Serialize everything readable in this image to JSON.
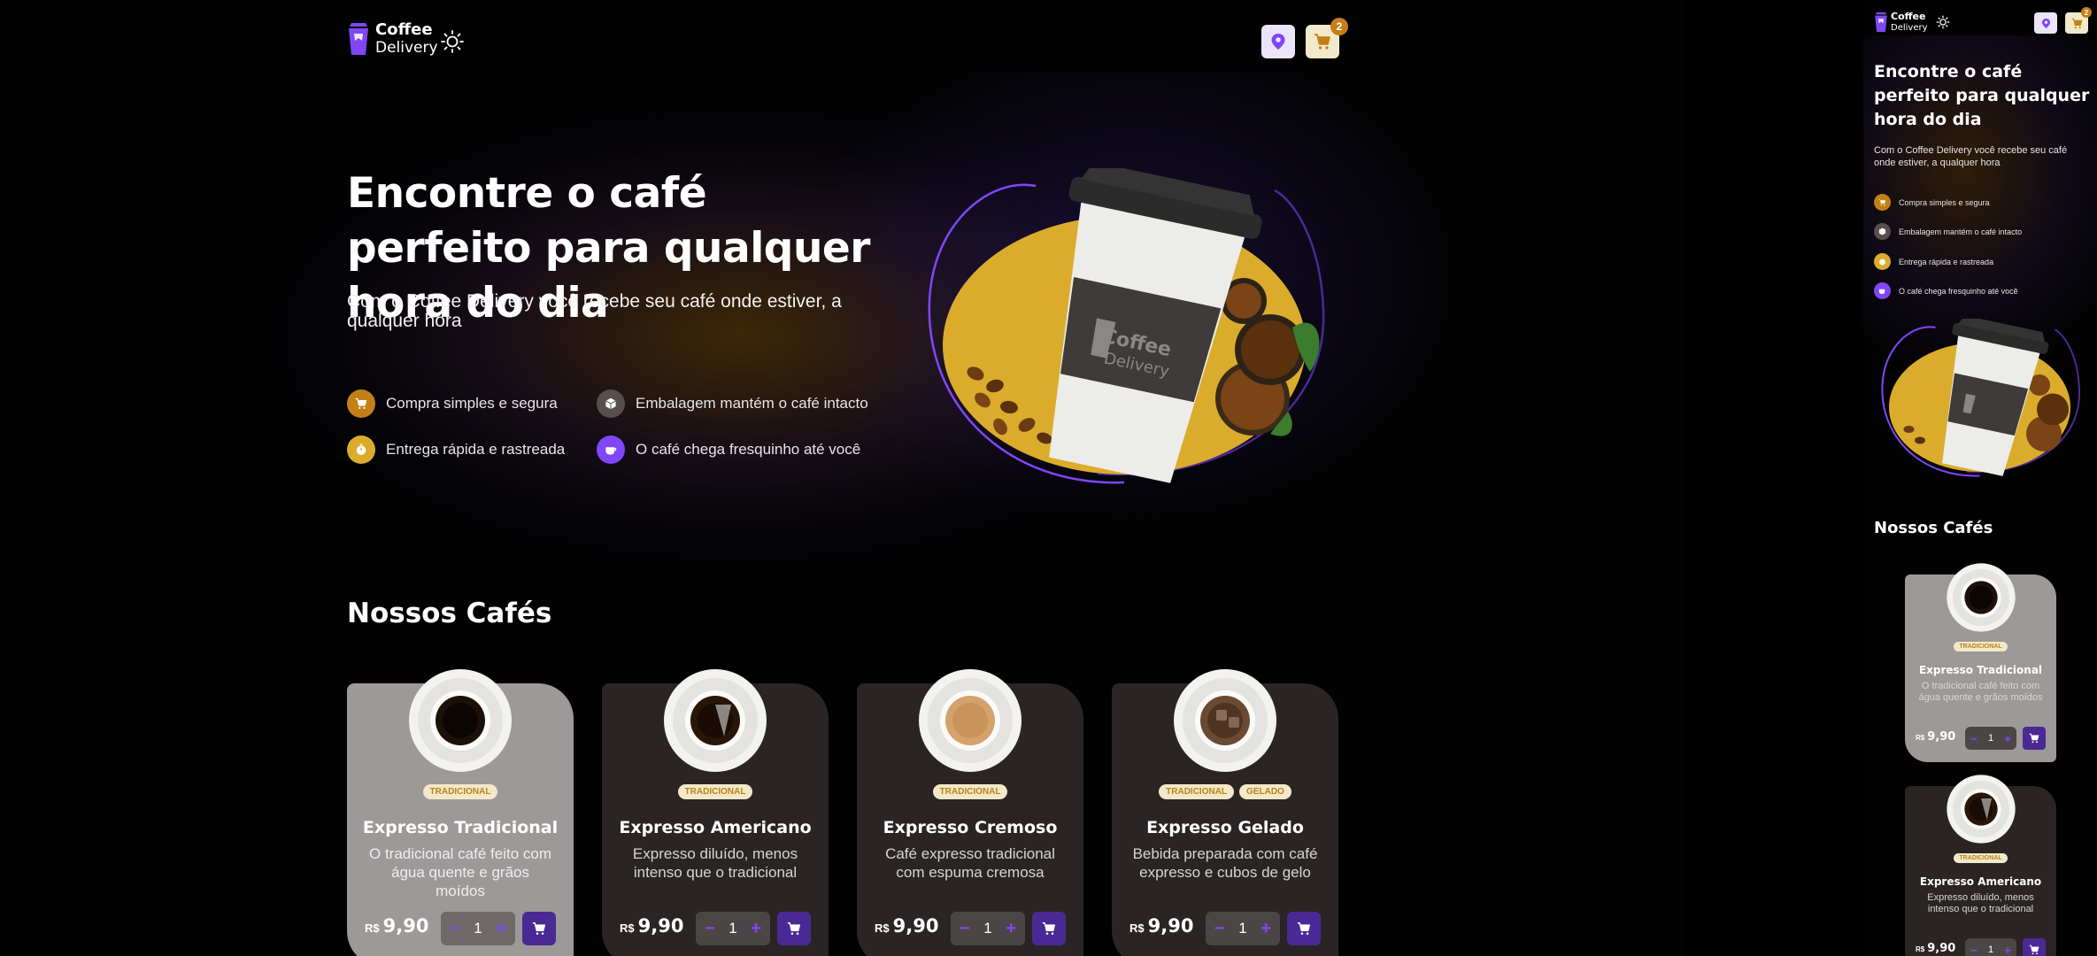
{
  "brand": {
    "line1": "Coffee",
    "line2": "Delivery"
  },
  "header": {
    "cart_count": "2",
    "location_icon": "map-pin-icon",
    "cart_icon": "shopping-cart-icon",
    "theme_icon": "sun-icon"
  },
  "hero": {
    "title": "Encontre o café perfeito para qualquer hora do dia",
    "subtitle": "Com o Coffee Delivery você recebe seu café onde estiver, a qualquer hora",
    "features": [
      {
        "label": "Compra simples e segura",
        "icon": "cart-icon",
        "color": "#c47f17"
      },
      {
        "label": "Embalagem mantém o café intacto",
        "icon": "package-icon",
        "color": "#574f4d"
      },
      {
        "label": "Entrega rápida e rastreada",
        "icon": "timer-icon",
        "color": "#dbac2c"
      },
      {
        "label": "O café chega fresquinho até você",
        "icon": "coffee-icon",
        "color": "#8047f8"
      }
    ],
    "image_label": "Coffee Delivery"
  },
  "catalog": {
    "title": "Nossos Cafés",
    "currency": "R$",
    "items": [
      {
        "name": "Expresso Tradicional",
        "description": "O tradicional café feito com água quente e grãos moídos",
        "tags": [
          "TRADICIONAL"
        ],
        "price": "9,90",
        "qty": "1",
        "style": "black"
      },
      {
        "name": "Expresso Americano",
        "description": "Expresso diluído, menos intenso que o tradicional",
        "tags": [
          "TRADICIONAL"
        ],
        "price": "9,90",
        "qty": "1",
        "style": "americano"
      },
      {
        "name": "Expresso Cremoso",
        "description": "Café expresso tradicional com espuma cremosa",
        "tags": [
          "TRADICIONAL"
        ],
        "price": "9,90",
        "qty": "1",
        "style": "cream"
      },
      {
        "name": "Expresso Gelado",
        "description": "Bebida preparada com café expresso e cubos de gelo",
        "tags": [
          "TRADICIONAL",
          "GELADO"
        ],
        "price": "9,90",
        "qty": "1",
        "style": "iced"
      }
    ]
  },
  "colors": {
    "purple": "#8047f8",
    "purple_dark": "#4b2995",
    "yellow": "#dbac2c",
    "yellow_dark": "#c47f17"
  }
}
